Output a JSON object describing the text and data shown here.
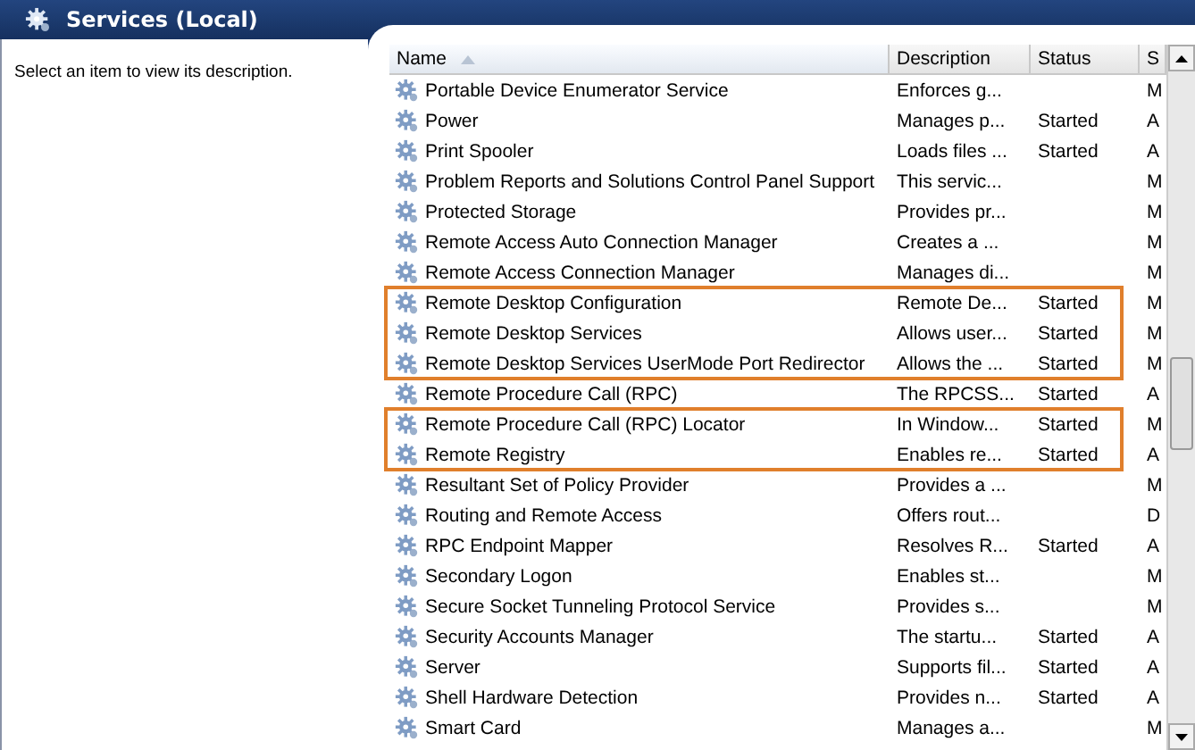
{
  "header": {
    "title": "Services (Local)"
  },
  "description_pane": {
    "text": "Select an item to view its description."
  },
  "table": {
    "columns": [
      {
        "label": "Name",
        "sorted": true
      },
      {
        "label": "Description",
        "sorted": false
      },
      {
        "label": "Status",
        "sorted": false
      },
      {
        "label": "S",
        "sorted": false
      }
    ],
    "rows": [
      {
        "name": "Portable Device Enumerator Service",
        "description": "Enforces g...",
        "status": "",
        "startup": "M",
        "highlighted": false
      },
      {
        "name": "Power",
        "description": "Manages p...",
        "status": "Started",
        "startup": "A",
        "highlighted": false
      },
      {
        "name": "Print Spooler",
        "description": "Loads files ...",
        "status": "Started",
        "startup": "A",
        "highlighted": false
      },
      {
        "name": "Problem Reports and Solutions Control Panel Support",
        "description": "This servic...",
        "status": "",
        "startup": "M",
        "highlighted": false
      },
      {
        "name": "Protected Storage",
        "description": "Provides pr...",
        "status": "",
        "startup": "M",
        "highlighted": false
      },
      {
        "name": "Remote Access Auto Connection Manager",
        "description": "Creates a ...",
        "status": "",
        "startup": "M",
        "highlighted": false
      },
      {
        "name": "Remote Access Connection Manager",
        "description": "Manages di...",
        "status": "",
        "startup": "M",
        "highlighted": false
      },
      {
        "name": "Remote Desktop Configuration",
        "description": "Remote De...",
        "status": "Started",
        "startup": "M",
        "highlighted": true
      },
      {
        "name": "Remote Desktop Services",
        "description": "Allows user...",
        "status": "Started",
        "startup": "M",
        "highlighted": true
      },
      {
        "name": "Remote Desktop Services UserMode Port Redirector",
        "description": "Allows the ...",
        "status": "Started",
        "startup": "M",
        "highlighted": true
      },
      {
        "name": "Remote Procedure Call (RPC)",
        "description": "The RPCSS...",
        "status": "Started",
        "startup": "A",
        "highlighted": false
      },
      {
        "name": "Remote Procedure Call (RPC) Locator",
        "description": "In Window...",
        "status": "Started",
        "startup": "M",
        "highlighted": true
      },
      {
        "name": "Remote Registry",
        "description": "Enables re...",
        "status": "Started",
        "startup": "A",
        "highlighted": true
      },
      {
        "name": "Resultant Set of Policy Provider",
        "description": "Provides a ...",
        "status": "",
        "startup": "M",
        "highlighted": false
      },
      {
        "name": "Routing and Remote Access",
        "description": "Offers rout...",
        "status": "",
        "startup": "D",
        "highlighted": false
      },
      {
        "name": "RPC Endpoint Mapper",
        "description": "Resolves R...",
        "status": "Started",
        "startup": "A",
        "highlighted": false
      },
      {
        "name": "Secondary Logon",
        "description": "Enables st...",
        "status": "",
        "startup": "M",
        "highlighted": false
      },
      {
        "name": "Secure Socket Tunneling Protocol Service",
        "description": "Provides s...",
        "status": "",
        "startup": "M",
        "highlighted": false
      },
      {
        "name": "Security Accounts Manager",
        "description": "The startu...",
        "status": "Started",
        "startup": "A",
        "highlighted": false
      },
      {
        "name": "Server",
        "description": "Supports fil...",
        "status": "Started",
        "startup": "A",
        "highlighted": false
      },
      {
        "name": "Shell Hardware Detection",
        "description": "Provides n...",
        "status": "Started",
        "startup": "A",
        "highlighted": false
      },
      {
        "name": "Smart Card",
        "description": "Manages a...",
        "status": "",
        "startup": "M",
        "highlighted": false
      }
    ]
  }
}
